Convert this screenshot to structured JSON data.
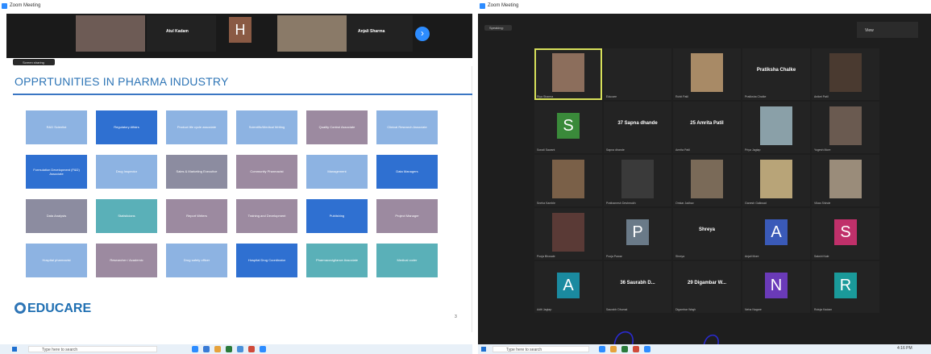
{
  "left": {
    "window_title": "Zoom Meeting",
    "strip_names": [
      "Atul Kadam",
      "Anjali Sharma"
    ],
    "avatar_letter": "H",
    "sharing_label": "Screen sharing",
    "slide": {
      "title": "OPPRTUNITIES IN PHARMA INDUSTRY",
      "rows": [
        [
          "R&D Scientist",
          "Regulatory Affairs",
          "Product life cycle associate",
          "Scientific/Medical Writing",
          "Quality Control Associate",
          "Clinical Research Associate"
        ],
        [
          "Formulation Development (F&D) Associate",
          "Drug Inspector",
          "Sales & Marketing Executive",
          "Community Pharmacist",
          "Management",
          "Data Managers"
        ],
        [
          "Data Analysts",
          "Statisticians",
          "Report Writers",
          "Training and Development",
          "Publishing",
          "Project Manager"
        ],
        [
          "Hospital pharmacist",
          "Researcher / Academic",
          "Drug safety officer",
          "Hospital Drug Coordinator",
          "Pharmacovigilance Associate",
          "Medical coder"
        ]
      ],
      "logo_text": "EDUCARE",
      "page_number": "3"
    },
    "taskbar_search": "Type here to search"
  },
  "right": {
    "window_title": "Zoom Meeting",
    "speaking_label": "Speaking:",
    "view_label": "View",
    "tiles": [
      {
        "kind": "photo",
        "label": "",
        "name": "Riya Sharma",
        "color": "#8c6e5c",
        "active": true
      },
      {
        "kind": "blank",
        "label": "",
        "name": "Educare"
      },
      {
        "kind": "photo",
        "label": "",
        "name": "Rohit Patil",
        "color": "#a88a66"
      },
      {
        "kind": "text",
        "label": "Pratiksha Chalke",
        "name": "Pratiksha Chalke"
      },
      {
        "kind": "photo",
        "label": "",
        "name": "Aniket Patil",
        "color": "#4a3a30"
      },
      {
        "kind": "letter",
        "label": "S",
        "name": "Sonali Sawant",
        "color": "#3a8a3a"
      },
      {
        "kind": "text",
        "label": "37 Sapna dhande",
        "name": "Sapna dhande"
      },
      {
        "kind": "text",
        "label": "25 Amrita Patil",
        "name": "Amrita Patil"
      },
      {
        "kind": "photo",
        "label": "",
        "name": "Priya Jagtap",
        "color": "#8aa0a8"
      },
      {
        "kind": "photo",
        "label": "",
        "name": "Yogesh More",
        "color": "#6a5a50"
      },
      {
        "kind": "photo",
        "label": "",
        "name": "Sneha Kamble",
        "color": "#7a6048"
      },
      {
        "kind": "photo",
        "label": "",
        "name": "Prathamesh Deshmukh",
        "color": "#3a3a3a"
      },
      {
        "kind": "photo",
        "label": "",
        "name": "Omkar Jadhav",
        "color": "#7a6a58"
      },
      {
        "kind": "photo",
        "label": "",
        "name": "Ganesh Gaikwad",
        "color": "#b8a478"
      },
      {
        "kind": "photo",
        "label": "",
        "name": "Vikas Shinde",
        "color": "#9a8c7a"
      },
      {
        "kind": "photo",
        "label": "",
        "name": "Pooja Bhosale",
        "color": "#5a3a36"
      },
      {
        "kind": "letter",
        "label": "P",
        "name": "Pooja Pawar",
        "color": "#6a7a88"
      },
      {
        "kind": "text",
        "label": "Shreya",
        "name": "Shreya"
      },
      {
        "kind": "letter",
        "label": "A",
        "name": "Anjali More",
        "color": "#3a5ab8"
      },
      {
        "kind": "letter",
        "label": "S",
        "name": "Sakshi Kale",
        "color": "#c0306a"
      },
      {
        "kind": "letter",
        "label": "A",
        "name": "Aditi Jagtap",
        "color": "#1a8aa0"
      },
      {
        "kind": "text",
        "label": "36 Saurabh D...",
        "name": "Saurabh Dhumal"
      },
      {
        "kind": "text",
        "label": "29 Digambar W...",
        "name": "Digambar Wagh"
      },
      {
        "kind": "letter",
        "label": "N",
        "name": "Neha Nagare",
        "color": "#6a3ab8"
      },
      {
        "kind": "letter",
        "label": "R",
        "name": "Rutuja Kadam",
        "color": "#1a9a9a"
      }
    ],
    "taskbar_search": "Type here to search",
    "tray_time": "4:16 PM"
  },
  "colors": {
    "slide_light_blue": "#8db3e2",
    "slide_dark_blue": "#2f70d1",
    "slide_gray": "#8c8ca0",
    "slide_mauve": "#9c8aa0",
    "slide_teal": "#5ab0b8",
    "zoom_blue": "#2d8cff",
    "annotation": "#2a2ad0"
  },
  "icons": [
    "zoom-icon",
    "next-page-icon",
    "windows-start-icon",
    "search-icon"
  ]
}
